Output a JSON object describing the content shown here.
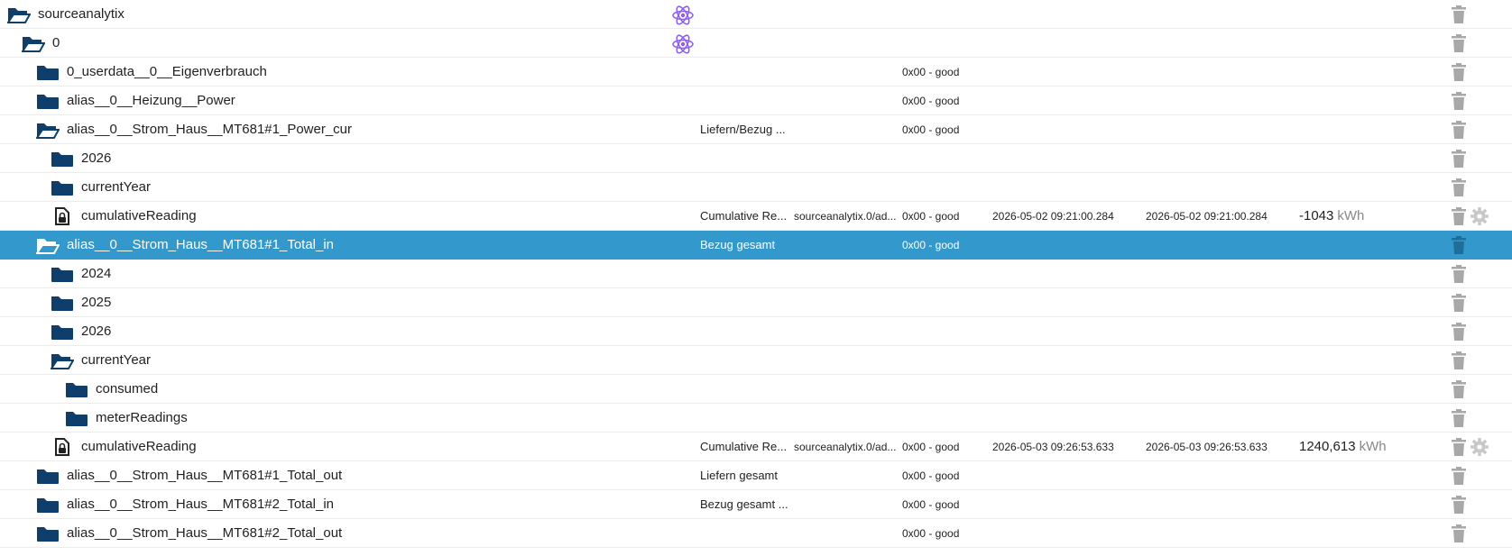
{
  "colors": {
    "folder": "#0f3e6b",
    "selected_bg": "#3399cc",
    "trash": "#a8a8a8",
    "gear": "#c8c8c8",
    "adapter": "#8b5cf6"
  },
  "rows": [
    {
      "label": "sourceanalytix",
      "level": 0,
      "icon": "folder-open-icon",
      "adapter": true,
      "desc": "",
      "src": "",
      "quality": "",
      "ts": "",
      "lc": "",
      "value": "",
      "unit": "",
      "gear": false,
      "selected": false
    },
    {
      "label": "0",
      "level": 1,
      "icon": "folder-open-icon",
      "adapter": true,
      "desc": "",
      "src": "",
      "quality": "",
      "ts": "",
      "lc": "",
      "value": "",
      "unit": "",
      "gear": false,
      "selected": false
    },
    {
      "label": "0_userdata__0__Eigenverbrauch",
      "level": 2,
      "icon": "folder-icon",
      "adapter": false,
      "desc": "",
      "src": "",
      "quality": "0x00 - good",
      "ts": "",
      "lc": "",
      "value": "",
      "unit": "",
      "gear": false,
      "selected": false
    },
    {
      "label": "alias__0__Heizung__Power",
      "level": 2,
      "icon": "folder-icon",
      "adapter": false,
      "desc": "",
      "src": "",
      "quality": "0x00 - good",
      "ts": "",
      "lc": "",
      "value": "",
      "unit": "",
      "gear": false,
      "selected": false
    },
    {
      "label": "alias__0__Strom_Haus__MT681#1_Power_cur",
      "level": 2,
      "icon": "folder-open-icon",
      "adapter": false,
      "desc": "Liefern/Bezug ...",
      "src": "",
      "quality": "0x00 - good",
      "ts": "",
      "lc": "",
      "value": "",
      "unit": "",
      "gear": false,
      "selected": false
    },
    {
      "label": "2026",
      "level": 3,
      "icon": "folder-icon",
      "adapter": false,
      "desc": "",
      "src": "",
      "quality": "",
      "ts": "",
      "lc": "",
      "value": "",
      "unit": "",
      "gear": false,
      "selected": false
    },
    {
      "label": "currentYear",
      "level": 3,
      "icon": "folder-icon",
      "adapter": false,
      "desc": "",
      "src": "",
      "quality": "",
      "ts": "",
      "lc": "",
      "value": "",
      "unit": "",
      "gear": false,
      "selected": false
    },
    {
      "label": "cumulativeReading",
      "level": 3,
      "icon": "file-lock-icon",
      "adapter": false,
      "desc": "Cumulative Re...",
      "src": "sourceanalytix.0/ad...",
      "quality": "0x00 - good",
      "ts": "2026-05-02 09:21:00.284",
      "lc": "2026-05-02 09:21:00.284",
      "value": "-1043",
      "unit": "kWh",
      "gear": true,
      "selected": false
    },
    {
      "label": "alias__0__Strom_Haus__MT681#1_Total_in",
      "level": 2,
      "icon": "folder-open-icon",
      "adapter": false,
      "desc": "Bezug gesamt",
      "src": "",
      "quality": "0x00 - good",
      "ts": "",
      "lc": "",
      "value": "",
      "unit": "",
      "gear": false,
      "selected": true
    },
    {
      "label": "2024",
      "level": 3,
      "icon": "folder-icon",
      "adapter": false,
      "desc": "",
      "src": "",
      "quality": "",
      "ts": "",
      "lc": "",
      "value": "",
      "unit": "",
      "gear": false,
      "selected": false
    },
    {
      "label": "2025",
      "level": 3,
      "icon": "folder-icon",
      "adapter": false,
      "desc": "",
      "src": "",
      "quality": "",
      "ts": "",
      "lc": "",
      "value": "",
      "unit": "",
      "gear": false,
      "selected": false
    },
    {
      "label": "2026",
      "level": 3,
      "icon": "folder-icon",
      "adapter": false,
      "desc": "",
      "src": "",
      "quality": "",
      "ts": "",
      "lc": "",
      "value": "",
      "unit": "",
      "gear": false,
      "selected": false
    },
    {
      "label": "currentYear",
      "level": 3,
      "icon": "folder-open-icon",
      "adapter": false,
      "desc": "",
      "src": "",
      "quality": "",
      "ts": "",
      "lc": "",
      "value": "",
      "unit": "",
      "gear": false,
      "selected": false
    },
    {
      "label": "consumed",
      "level": 4,
      "icon": "folder-icon",
      "adapter": false,
      "desc": "",
      "src": "",
      "quality": "",
      "ts": "",
      "lc": "",
      "value": "",
      "unit": "",
      "gear": false,
      "selected": false
    },
    {
      "label": "meterReadings",
      "level": 4,
      "icon": "folder-icon",
      "adapter": false,
      "desc": "",
      "src": "",
      "quality": "",
      "ts": "",
      "lc": "",
      "value": "",
      "unit": "",
      "gear": false,
      "selected": false
    },
    {
      "label": "cumulativeReading",
      "level": 3,
      "icon": "file-lock-icon",
      "adapter": false,
      "desc": "Cumulative Re...",
      "src": "sourceanalytix.0/ad...",
      "quality": "0x00 - good",
      "ts": "2026-05-03 09:26:53.633",
      "lc": "2026-05-03 09:26:53.633",
      "value": "1240,613",
      "unit": "kWh",
      "gear": true,
      "selected": false
    },
    {
      "label": "alias__0__Strom_Haus__MT681#1_Total_out",
      "level": 2,
      "icon": "folder-icon",
      "adapter": false,
      "desc": "Liefern gesamt",
      "src": "",
      "quality": "0x00 - good",
      "ts": "",
      "lc": "",
      "value": "",
      "unit": "",
      "gear": false,
      "selected": false
    },
    {
      "label": "alias__0__Strom_Haus__MT681#2_Total_in",
      "level": 2,
      "icon": "folder-icon",
      "adapter": false,
      "desc": "Bezug gesamt ...",
      "src": "",
      "quality": "0x00 - good",
      "ts": "",
      "lc": "",
      "value": "",
      "unit": "",
      "gear": false,
      "selected": false
    },
    {
      "label": "alias__0__Strom_Haus__MT681#2_Total_out",
      "level": 2,
      "icon": "folder-icon",
      "adapter": false,
      "desc": "",
      "src": "",
      "quality": "0x00 - good",
      "ts": "",
      "lc": "",
      "value": "",
      "unit": "",
      "gear": false,
      "selected": false
    }
  ]
}
